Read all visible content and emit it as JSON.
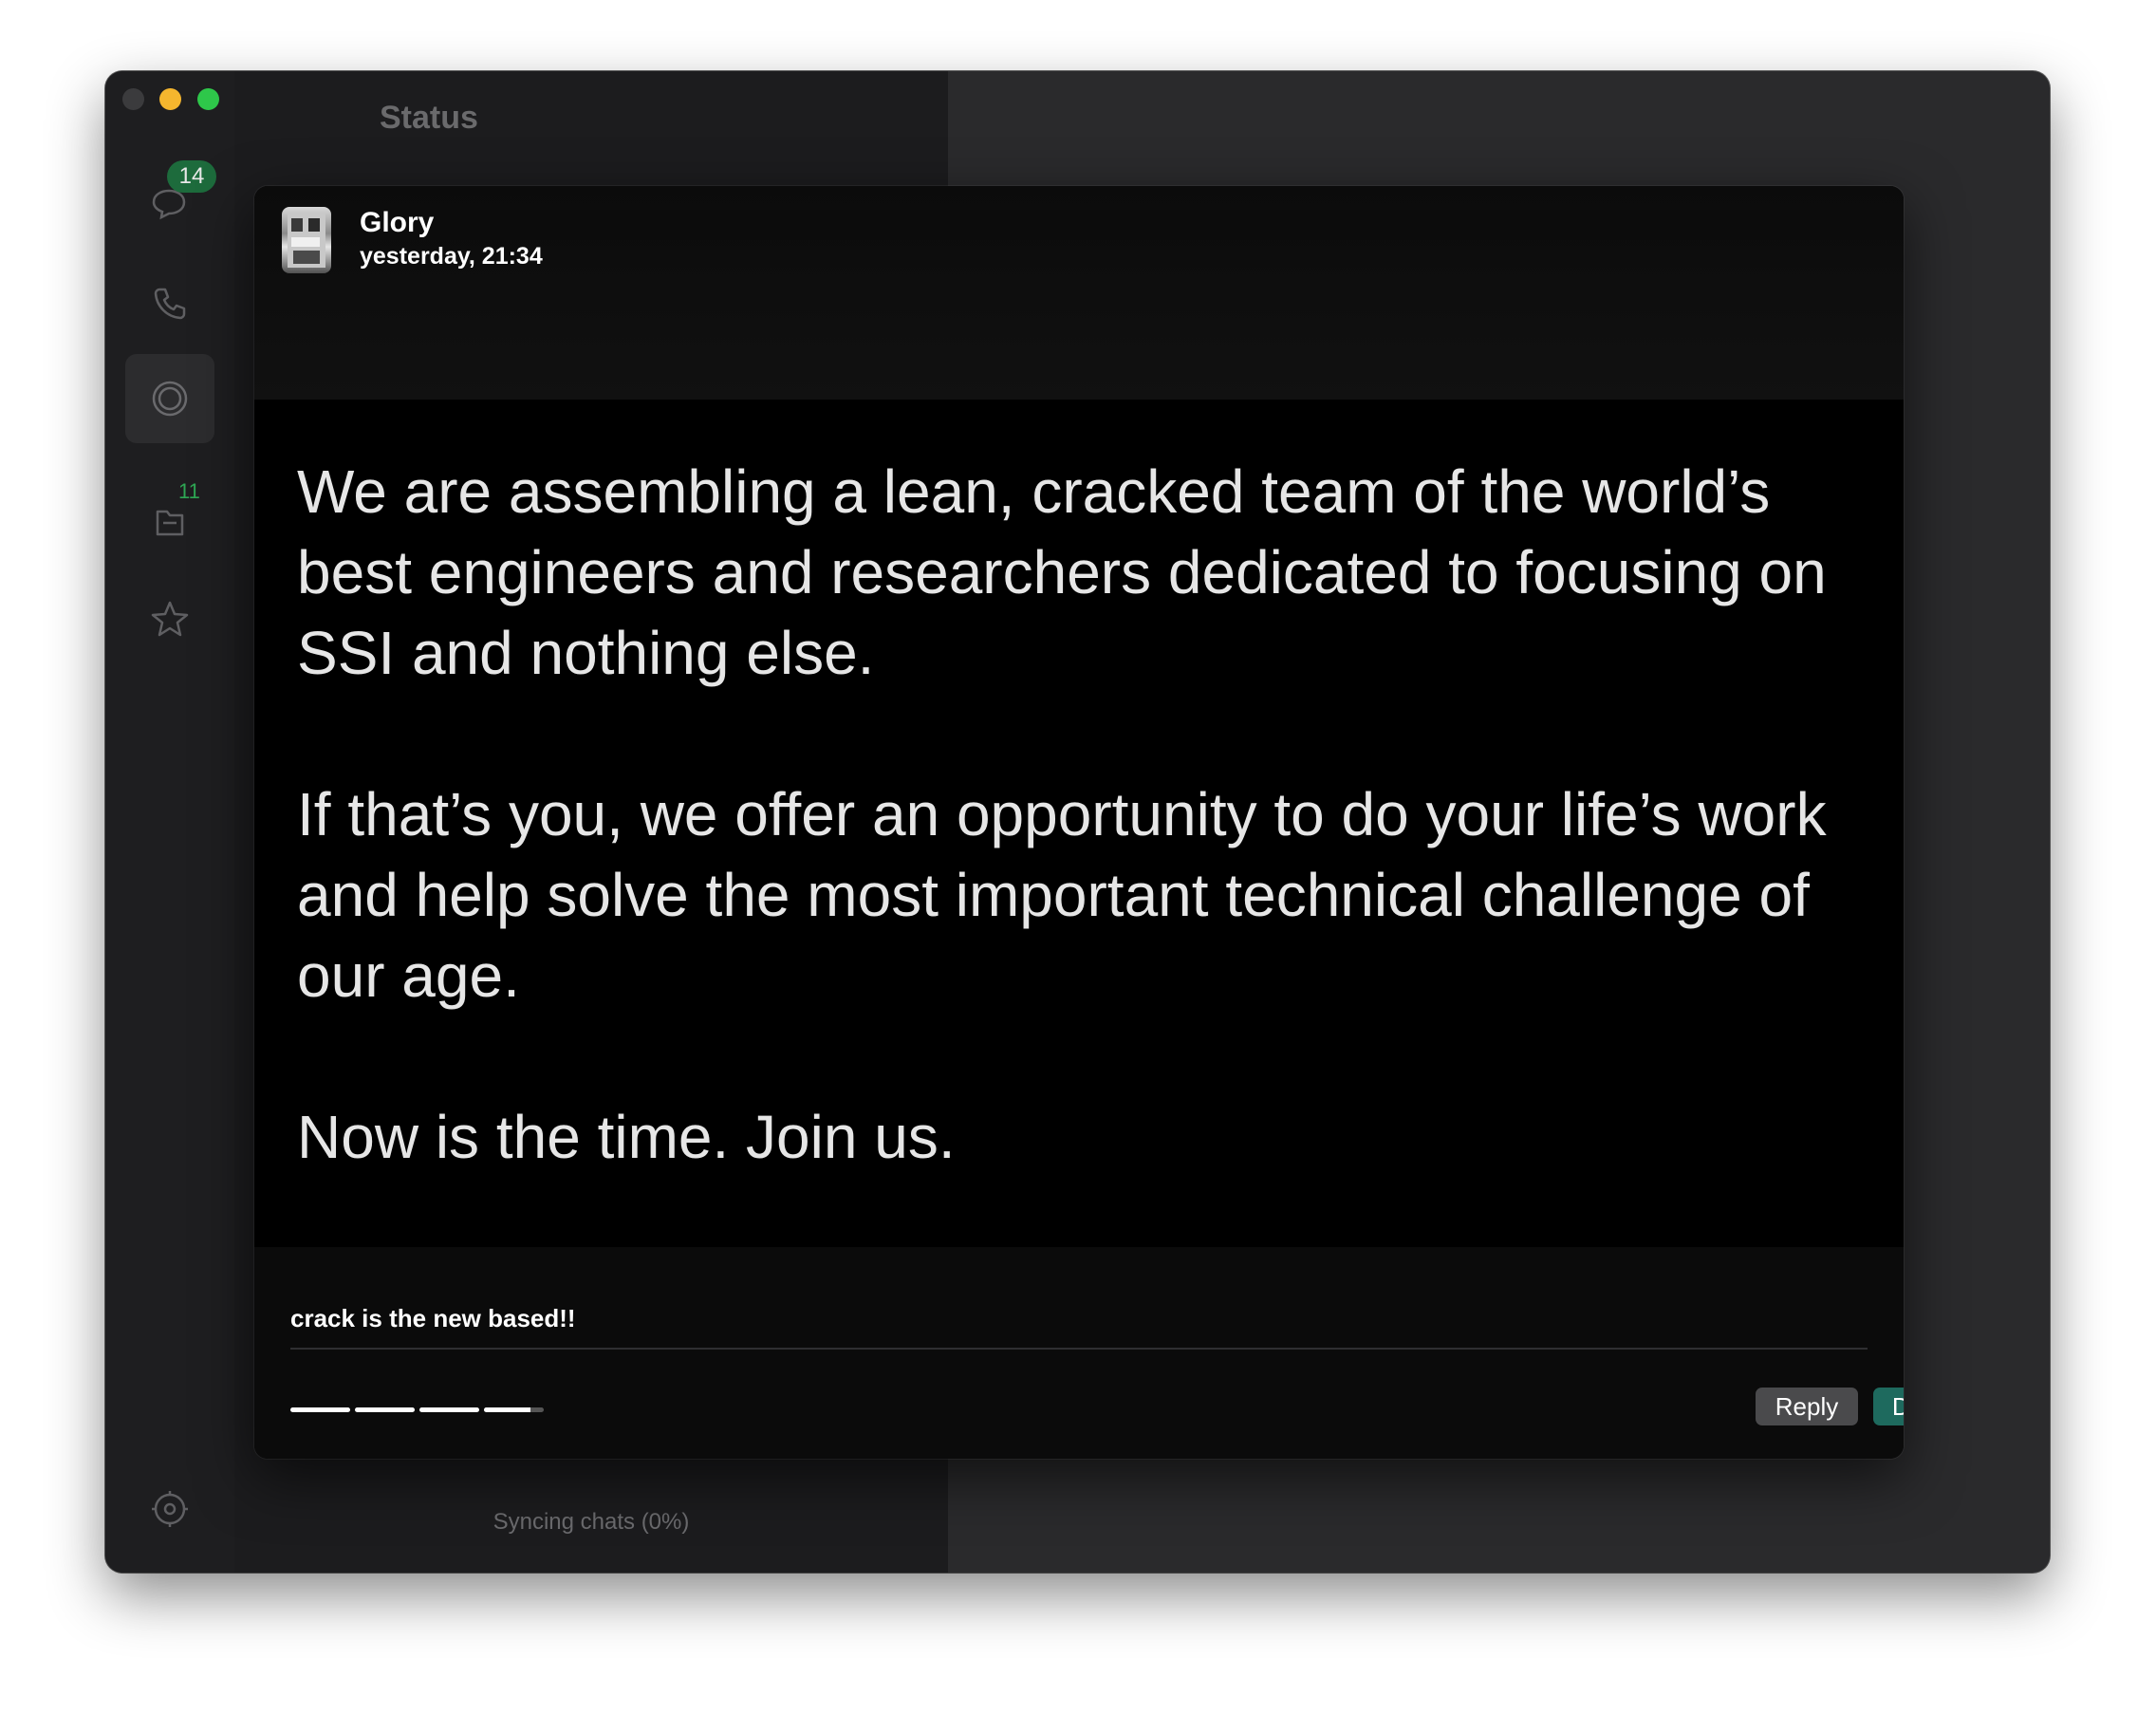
{
  "sidebar": {
    "chats_badge": "14",
    "archive_count": "11"
  },
  "list": {
    "title": "Status",
    "syncing": "Syncing chats (0%)"
  },
  "viewer": {
    "sender": "Glory",
    "time": "yesterday, 21:34",
    "paragraphs": [
      "We are assembling a lean, cracked team of the world’s best engineers and researchers dedicated to focusing on SSI and nothing else.",
      "If that’s you, we offer an opportunity to do your life’s work and help solve the most important technical challenge of our age.",
      "Now is the time. Join us."
    ],
    "caption": "crack is the new based!!",
    "progress": [
      1,
      1,
      1,
      0.78
    ],
    "reply_label": "Reply",
    "done_label": "Done"
  },
  "icons": [
    "chat-icon",
    "phone-icon",
    "status-icon",
    "archive-icon",
    "star-icon",
    "settings-icon"
  ],
  "colors": {
    "accent_green": "#2ec74a",
    "done_button": "#1e6a5e",
    "badge": "#1d6b3c"
  }
}
